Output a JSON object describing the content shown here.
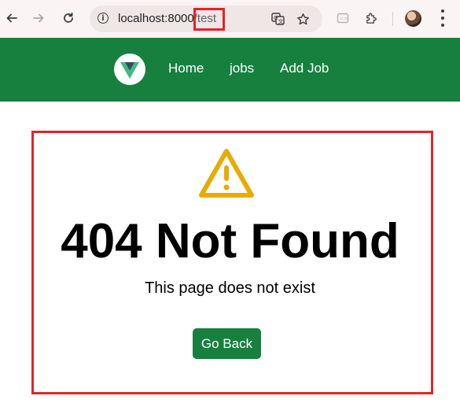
{
  "browser": {
    "url_host": "localhost:8000",
    "url_path": "/test",
    "highlight_color": "#e0242b"
  },
  "icons": {
    "back": "back-arrow-icon",
    "forward": "forward-arrow-icon",
    "reload": "reload-icon",
    "info": "info-icon",
    "translate": "translate-icon",
    "bookmark": "star-icon",
    "extension": "puzzle-icon",
    "warning": "warning-triangle-icon"
  },
  "navbar": {
    "background": "#17803f",
    "links": [
      "Home",
      "jobs",
      "Add Job"
    ]
  },
  "main": {
    "title": "404 Not Found",
    "subtitle": "This page does not exist",
    "button_label": "Go Back",
    "warning_color": "#e6ac00"
  }
}
